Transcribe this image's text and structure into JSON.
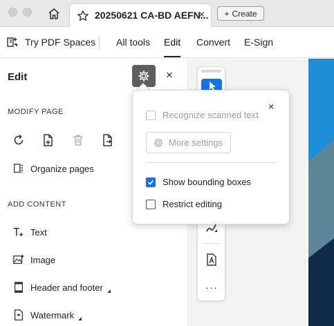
{
  "tab": {
    "title": "20250621 CA-BD AEFN...",
    "close": "×"
  },
  "create_button": {
    "label": "Create",
    "plus": "+"
  },
  "toolbar": {
    "pdf_spaces": "Try PDF Spaces",
    "all_tools": "All tools",
    "edit": "Edit",
    "convert": "Convert",
    "esign": "E-Sign"
  },
  "panel": {
    "title": "Edit",
    "close": "×",
    "modify_page_label": "MODIFY PAGE",
    "organize_pages": "Organize pages",
    "add_content_label": "ADD CONTENT",
    "items": [
      {
        "label": "Text",
        "icon": "add-text-icon"
      },
      {
        "label": "Image",
        "icon": "add-image-icon"
      },
      {
        "label": "Header and footer",
        "icon": "header-footer-icon"
      },
      {
        "label": "Watermark",
        "icon": "watermark-icon"
      }
    ]
  },
  "popover": {
    "close": "×",
    "recognize_text": "Recognize scanned text",
    "recognize_text_checked": false,
    "recognize_text_disabled": true,
    "more_settings": "More settings",
    "show_bounding_boxes": "Show bounding boxes",
    "show_bounding_boxes_checked": true,
    "restrict_editing": "Restrict editing",
    "restrict_editing_checked": false
  },
  "toolstrip": {
    "more": "···"
  },
  "colors": {
    "accent": "#1473e6",
    "gear_button": "#5e5e5e",
    "doc_teal": "#5d8799",
    "doc_blue": "#1d8fd8",
    "doc_navy": "#0f2d4a"
  }
}
